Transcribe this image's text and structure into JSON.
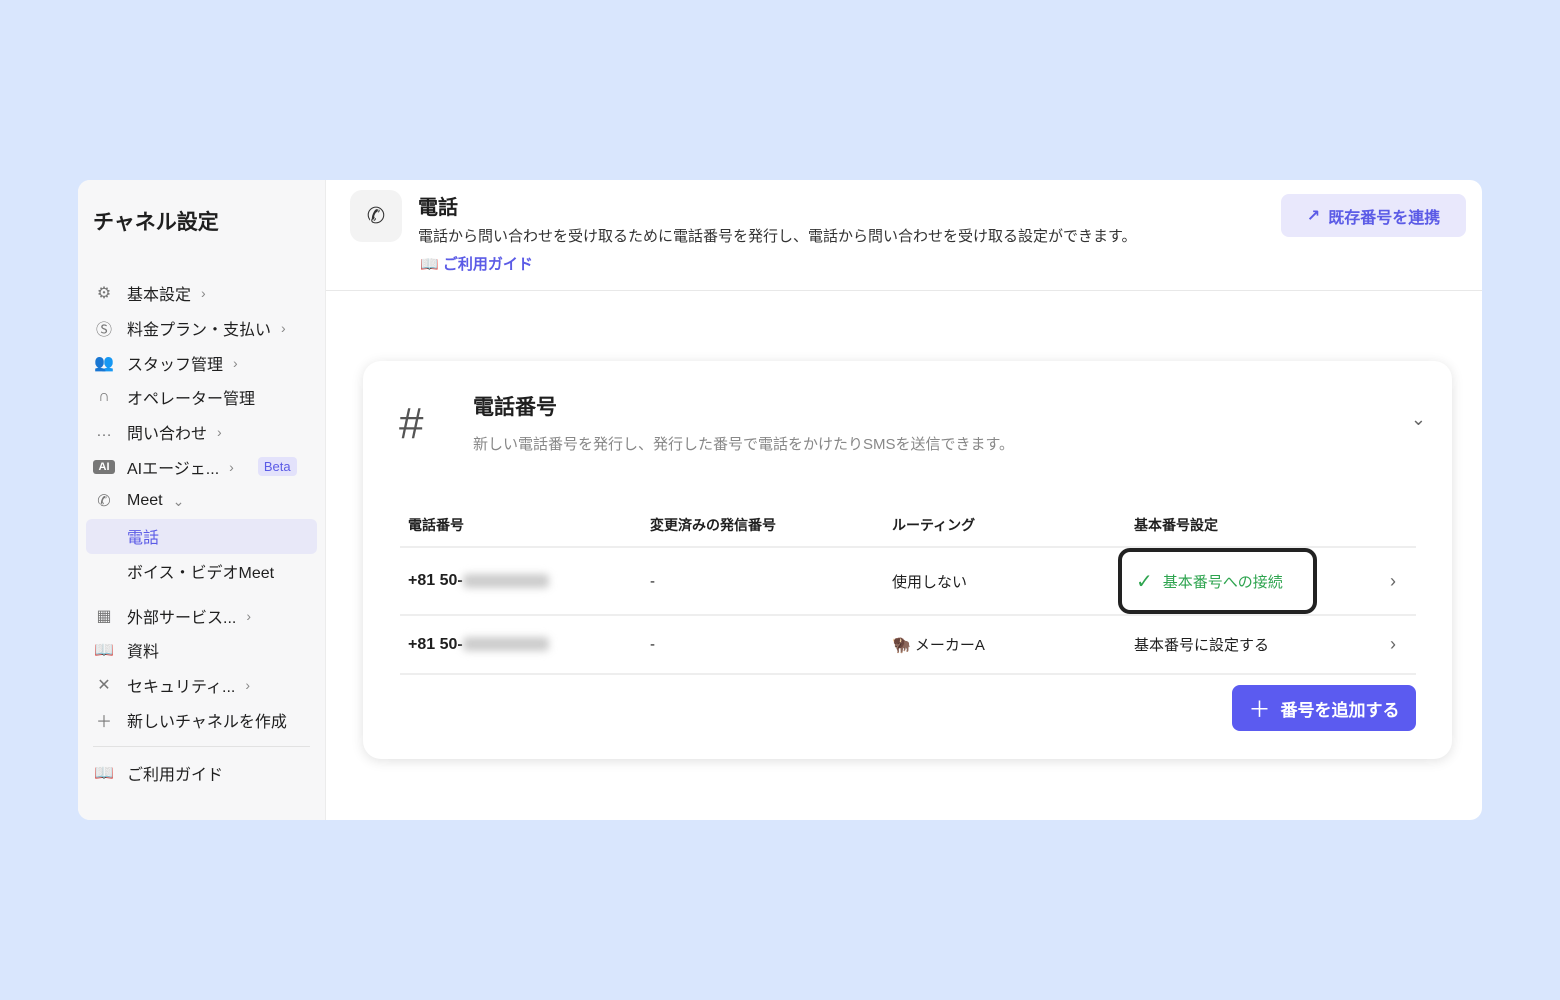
{
  "sidebar": {
    "title": "チャネル設定",
    "items": [
      {
        "label": "基本設定",
        "icon": "gear-icon"
      },
      {
        "label": "料金プラン・支払い",
        "icon": "dollar-icon"
      },
      {
        "label": "スタッフ管理",
        "icon": "users-icon"
      },
      {
        "label": "オペレーター管理",
        "icon": "headset-icon"
      },
      {
        "label": "問い合わせ",
        "icon": "chat-icon"
      },
      {
        "label": "AIエージェ...",
        "icon": "ai-icon",
        "badge": "Beta"
      },
      {
        "label": "Meet",
        "icon": "phone-icon"
      },
      {
        "label": "電話"
      },
      {
        "label": "ボイス・ビデオMeet"
      },
      {
        "label": "外部サービス...",
        "icon": "grid-icon"
      },
      {
        "label": "資料",
        "icon": "book-icon"
      },
      {
        "label": "セキュリティ...",
        "icon": "tools-icon"
      },
      {
        "label": "新しいチャネルを作成",
        "icon": "plus-icon"
      },
      {
        "label": "ご利用ガイド",
        "icon": "book-icon"
      }
    ]
  },
  "header": {
    "title": "電話",
    "description": "電話から問い合わせを受け取るために電話番号を発行し、電話から問い合わせを受け取る設定ができます。",
    "guide_link": "ご利用ガイド",
    "link_button": "既存番号を連携"
  },
  "card": {
    "title": "電話番号",
    "description": "新しい電話番号を発行し、発行した番号で電話をかけたりSMSを送信できます。",
    "columns": [
      "電話番号",
      "変更済みの発信番号",
      "ルーティング",
      "基本番号設定"
    ],
    "rows": [
      {
        "number": "+81 50-",
        "caller": "-",
        "routing": "使用しない",
        "base": "基本番号への接続"
      },
      {
        "number": "+81 50-",
        "caller": "-",
        "routing": "メーカーA",
        "base": "基本番号に設定する"
      }
    ],
    "add_button": "番号を追加する"
  },
  "colors": {
    "accent": "#5b5bf0",
    "success": "#2ea44f",
    "background": "#d9e6fd"
  }
}
